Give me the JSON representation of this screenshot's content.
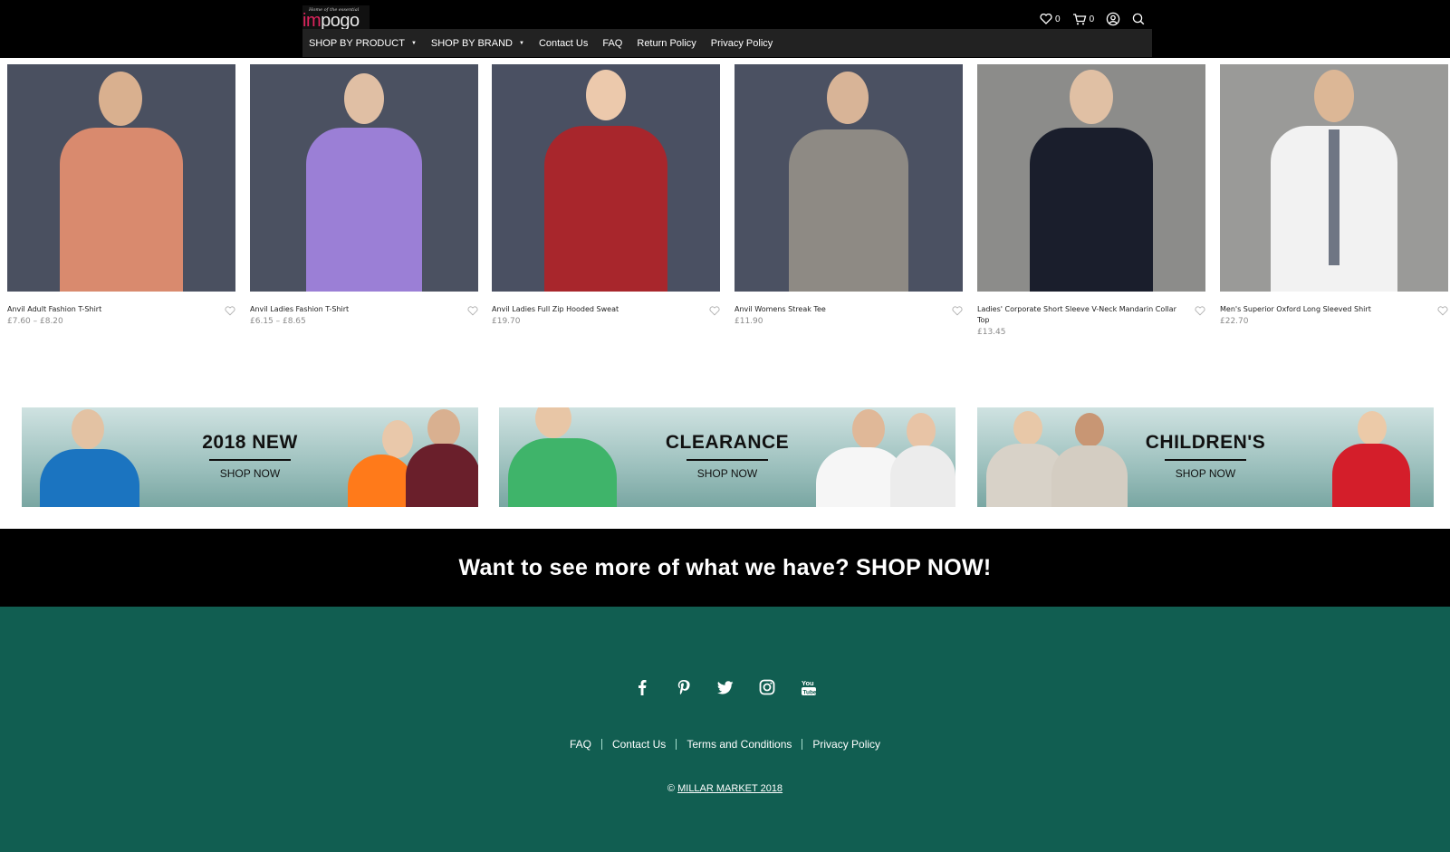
{
  "header": {
    "logo": {
      "tagline": "Home of the essential",
      "word_accent": "im",
      "word_rest": "pogo"
    },
    "icons": [
      {
        "name": "wishlist-heart-icon",
        "count": "0"
      },
      {
        "name": "cart-icon",
        "count": "0"
      },
      {
        "name": "account-icon"
      },
      {
        "name": "search-icon"
      }
    ],
    "nav": [
      {
        "label": "SHOP BY PRODUCT",
        "has_dropdown": true
      },
      {
        "label": "SHOP BY BRAND",
        "has_dropdown": true
      },
      {
        "label": "Contact Us"
      },
      {
        "label": "FAQ"
      },
      {
        "label": "Return Policy"
      },
      {
        "label": "Privacy Policy"
      }
    ]
  },
  "products": [
    {
      "name": "Anvil Adult Fashion T-Shirt",
      "price": "£7.60 – £8.20",
      "shirt_color": "#d98a6e"
    },
    {
      "name": "Anvil Ladies Fashion T-Shirt",
      "price": "£6.15 – £8.65",
      "shirt_color": "#9b7fd6"
    },
    {
      "name": "Anvil Ladies Full Zip Hooded Sweat",
      "price": "£19.70",
      "shirt_color": "#a8262c"
    },
    {
      "name": "Anvil Womens Streak Tee",
      "price": "£11.90",
      "shirt_color": "#8e8a84"
    },
    {
      "name": "Ladies' Corporate Short Sleeve V-Neck Mandarin Collar Top",
      "price": "£13.45",
      "shirt_color": "#1a1e2c"
    },
    {
      "name": "Men's Superior Oxford Long Sleeved Shirt",
      "price": "£22.70",
      "shirt_color": "#f2f2f2"
    }
  ],
  "banners": [
    {
      "title": "2018 NEW",
      "cta": "SHOP NOW"
    },
    {
      "title": "CLEARANCE",
      "cta": "SHOP NOW"
    },
    {
      "title": "CHILDREN'S",
      "cta": "SHOP NOW"
    }
  ],
  "cta_strip": {
    "text": "Want to see more of what we have? SHOP NOW!"
  },
  "footer": {
    "social": [
      "facebook-icon",
      "pinterest-icon",
      "twitter-icon",
      "instagram-icon",
      "youtube-icon"
    ],
    "links": [
      "FAQ",
      "Contact Us",
      "Terms and Conditions",
      "Privacy Policy"
    ],
    "copyright_symbol": "©",
    "copyright_link": "MILLAR MARKET 2018"
  },
  "colors": {
    "header_bg": "#000000",
    "nav_bg": "#222222",
    "logo_accent": "#e0245e",
    "footer_bg": "#115e51",
    "price_grey": "#8a8a8a"
  }
}
